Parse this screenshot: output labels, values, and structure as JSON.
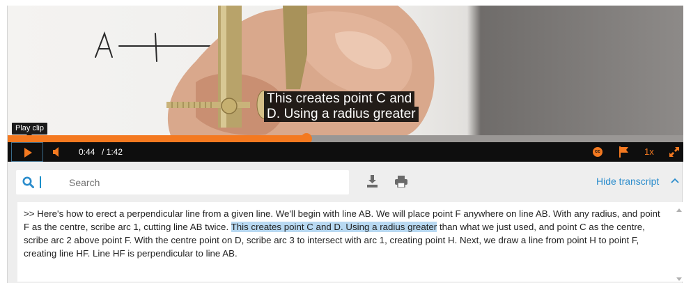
{
  "video": {
    "caption_lines": [
      "This creates point C and",
      "D. Using a radius greater"
    ],
    "tooltip": "Play clip",
    "progress_fraction": 0.4422
  },
  "controls": {
    "current_time": "0:44",
    "duration": "/ 1:42",
    "cc_label": "cc",
    "speed": "1x",
    "accent_color": "#f47920"
  },
  "toolbar": {
    "search_placeholder": "Search",
    "hide_transcript_label": "Hide transcript",
    "icons": [
      "search-icon",
      "download-icon",
      "print-icon",
      "chevron-up-icon"
    ]
  },
  "transcript": {
    "text_before": ">> Here's how to erect a perpendicular line from a given line. We'll begin with line AB. We will place point F anywhere on line AB. With any radius, and point F as the centre, scribe arc 1, cutting line AB twice. ",
    "highlighted": "This creates point C and D. Using a radius greater",
    "text_after": " than what we just used, and point C as the centre, scribe arc 2 above point F. With the centre point on D, scribe arc 3 to intersect with arc 1, creating point H. Next, we draw a line from point H to point F, creating line HF. Line HF is perpendicular to line AB.",
    "highlight_color": "#b8d9f2"
  }
}
